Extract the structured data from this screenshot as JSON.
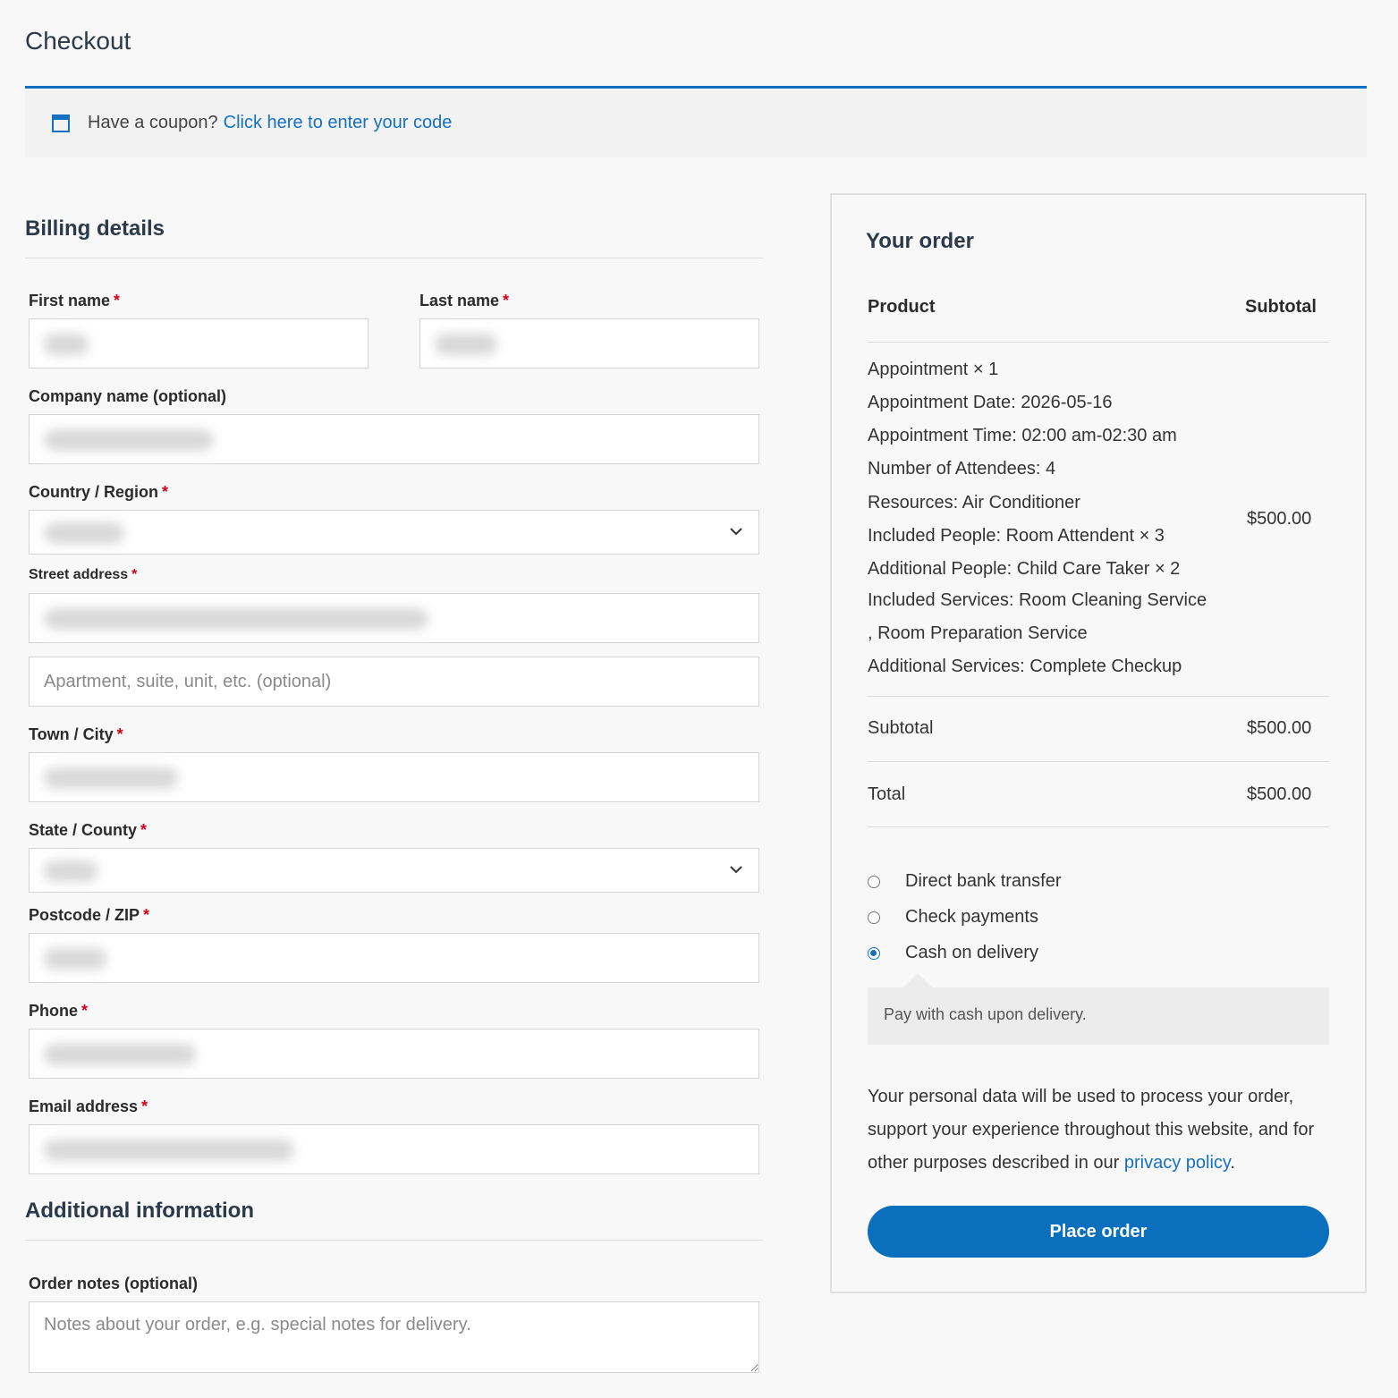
{
  "page": {
    "title": "Checkout"
  },
  "coupon": {
    "text": "Have a coupon?",
    "link": "Click here to enter your code"
  },
  "billing": {
    "title": "Billing details",
    "first_name_label": "First name",
    "last_name_label": "Last name",
    "company_label": "Company name (optional)",
    "country_label": "Country / Region",
    "street_label": "Street address",
    "street2_placeholder": "Apartment, suite, unit, etc. (optional)",
    "city_label": "Town / City",
    "state_label": "State / County",
    "postcode_label": "Postcode / ZIP",
    "phone_label": "Phone",
    "email_label": "Email address",
    "required_mark": "*"
  },
  "additional": {
    "title": "Additional information",
    "notes_label": "Order notes (optional)",
    "notes_placeholder": "Notes about your order, e.g. special notes for delivery."
  },
  "order": {
    "title": "Your order",
    "col_product": "Product",
    "col_subtotal": "Subtotal",
    "item_name": "Appointment",
    "item_qty": "× 1",
    "meta": [
      {
        "key": "Appointment Date:",
        "value": "2026-05-16"
      },
      {
        "key": "Appointment Time:",
        "value": "02:00 am-02:30 am"
      },
      {
        "key": "Number of Attendees:",
        "value": "4"
      },
      {
        "key": "Resources:",
        "value": "Air Conditioner"
      },
      {
        "key": "Included People:",
        "value": "Room Attendent × 3"
      },
      {
        "key": "Additional People:",
        "value": "Child Care Taker × 2"
      },
      {
        "key": "Included Services:",
        "value": "Room Cleaning Service"
      },
      {
        "key": "",
        "value": ", Room Preparation Service"
      },
      {
        "key": "Additional Services:",
        "value": "Complete Checkup"
      }
    ],
    "item_price": "$500.00",
    "subtotal_label": "Subtotal",
    "subtotal_value": "$500.00",
    "total_label": "Total",
    "total_value": "$500.00"
  },
  "payment": {
    "methods": [
      "Direct bank transfer",
      "Check payments",
      "Cash on delivery"
    ],
    "selected": "Cash on delivery",
    "description": "Pay with cash upon delivery.",
    "privacy_text": "Your personal data will be used to process your order, support your experience throughout this website, and for other purposes described in our",
    "privacy_link": "privacy policy",
    "privacy_end": ".",
    "place_order": "Place order"
  },
  "colors": {
    "accent": "#0a6fbd",
    "link": "#1570c2",
    "required": "#d0021b"
  }
}
